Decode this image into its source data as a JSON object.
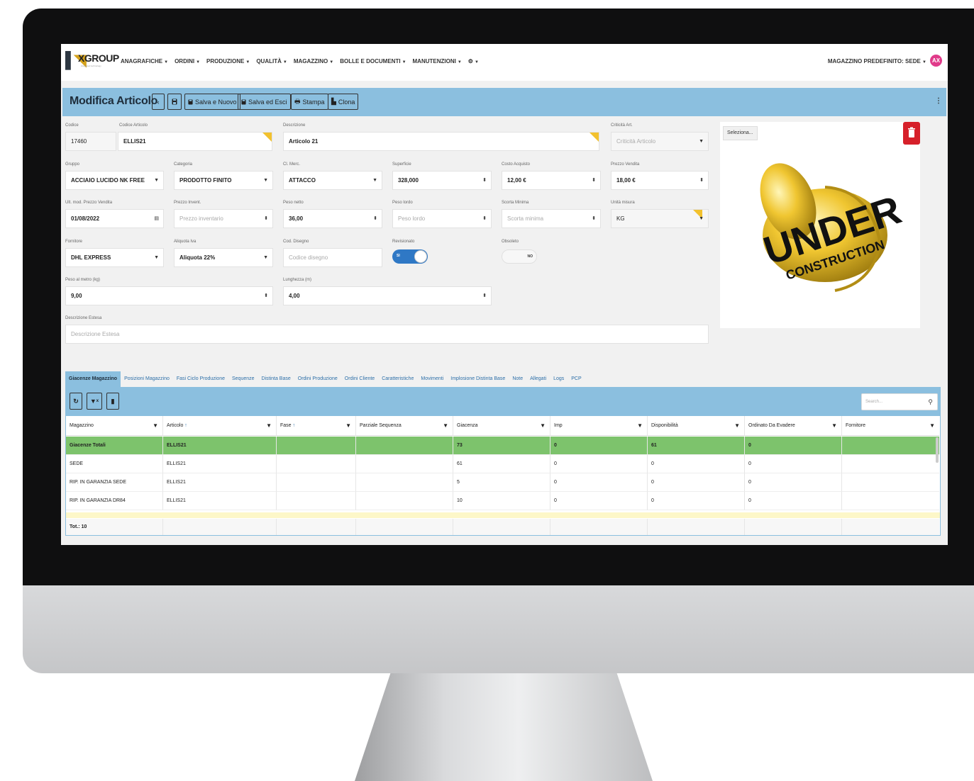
{
  "logo": {
    "brand": "XGROUP",
    "tagline": "integrated technology"
  },
  "nav": {
    "menu": [
      "ANAGRAFICHE",
      "ORDINI",
      "PRODUZIONE",
      "QUALITÀ",
      "MAGAZZINO",
      "BOLLE E DOCUMENTI",
      "MANUTENZIONI"
    ],
    "user_menu": "MAGAZZINO PREDEFINITO: SEDE",
    "avatar_initials": "AX"
  },
  "toolbar": {
    "title": "Modifica Articolo",
    "save_new": "Salva e Nuovo",
    "save_exit": "Salva ed Esci",
    "print": "Stampa",
    "clone": "Clona"
  },
  "form": {
    "codice": {
      "label": "Codice",
      "value": "17460"
    },
    "codice_articolo": {
      "label": "Codice Articolo",
      "value": "ELLIS21"
    },
    "descrizione": {
      "label": "Descrizione",
      "value": "Articolo 21"
    },
    "criticita": {
      "label": "Criticità Art.",
      "placeholder": "Criticità Articolo"
    },
    "gruppo": {
      "label": "Gruppo",
      "value": "ACCIAIO LUCIDO NK FREE"
    },
    "categoria": {
      "label": "Categoria",
      "value": "PRODOTTO FINITO"
    },
    "cl_merc": {
      "label": "Cl. Merc.",
      "value": "ATTACCO"
    },
    "superficie": {
      "label": "Superficie",
      "value": "328,000"
    },
    "costo_acquisto": {
      "label": "Costo Acquisto",
      "value": "12,00 €"
    },
    "prezzo_vendita": {
      "label": "Prezzo Vendita",
      "value": "18,00 €"
    },
    "ult_mod": {
      "label": "Ult. mod. Prezzo Vendita",
      "value": "01/08/2022"
    },
    "prezzo_invent": {
      "label": "Prezzo Invent.",
      "placeholder": "Prezzo inventario"
    },
    "peso_netto": {
      "label": "Peso netto",
      "value": "36,00"
    },
    "peso_lordo": {
      "label": "Peso lordo",
      "placeholder": "Peso lordo"
    },
    "scorta_minima": {
      "label": "Scorta Minima",
      "placeholder": "Scorta minima"
    },
    "unita_misura": {
      "label": "Unità misura",
      "value": "KG"
    },
    "fornitore": {
      "label": "Fornitore",
      "value": "DHL EXPRESS"
    },
    "aliquota_iva": {
      "label": "Aliquota Iva",
      "value": "Aliquota 22%"
    },
    "cod_disegno": {
      "label": "Cod. Disegno",
      "placeholder": "Codice disegno"
    },
    "revisionato": {
      "label": "Revisionato",
      "state": "SI"
    },
    "obsoleto": {
      "label": "Obsoleto",
      "state": "NO"
    },
    "peso_metro": {
      "label": "Peso al metro (kg)",
      "value": "9,00"
    },
    "lunghezza": {
      "label": "Lunghezza (m)",
      "value": "4,00"
    },
    "descrizione_estesa": {
      "label": "Descrizione Estesa",
      "placeholder": "Descrizione Estesa"
    }
  },
  "image_panel": {
    "select_label": "Seleziona...",
    "placeholder_line1": "UNDER",
    "placeholder_line2": "CONSTRUCTION"
  },
  "tabs": [
    "Giacenze Magazzino",
    "Posizioni Magazzino",
    "Fasi Ciclo Produzione",
    "Sequenze",
    "Distinta Base",
    "Ordini Produzione",
    "Ordini Cliente",
    "Caratteristiche",
    "Movimenti",
    "Implosione Distinta Base",
    "Note",
    "Allegati",
    "Logs",
    "PCP"
  ],
  "grid": {
    "search_placeholder": "Search...",
    "columns": [
      "Magazzino",
      "Articolo",
      "Fase",
      "Parziale Sequenza",
      "Giacenza",
      "Imp",
      "Disponibilità",
      "Ordinato Da Evadere",
      "Fornitore"
    ],
    "sort_marks": [
      "",
      "↑",
      "↑",
      "",
      "",
      "",
      "",
      "",
      ""
    ],
    "rows": [
      [
        "Giacenze Totali",
        "ELLIS21",
        "",
        "",
        "73",
        "0",
        "61",
        "0",
        ""
      ],
      [
        "SEDE",
        "ELLIS21",
        "",
        "",
        "61",
        "0",
        "0",
        "0",
        ""
      ],
      [
        "RIP. IN GARANZIA SEDE",
        "ELLIS21",
        "",
        "",
        "5",
        "0",
        "0",
        "0",
        ""
      ],
      [
        "RIP. IN GARANZIA DR84",
        "ELLIS21",
        "",
        "",
        "10",
        "0",
        "0",
        "0",
        ""
      ]
    ],
    "footer": "Tot.: 10"
  },
  "colors": {
    "toolbar_blue": "#8bbfdf",
    "total_row_green": "#7dc36c",
    "toggle_blue": "#2f78c5",
    "delete_red": "#d6202a",
    "avatar_pink": "#e03b8a"
  }
}
